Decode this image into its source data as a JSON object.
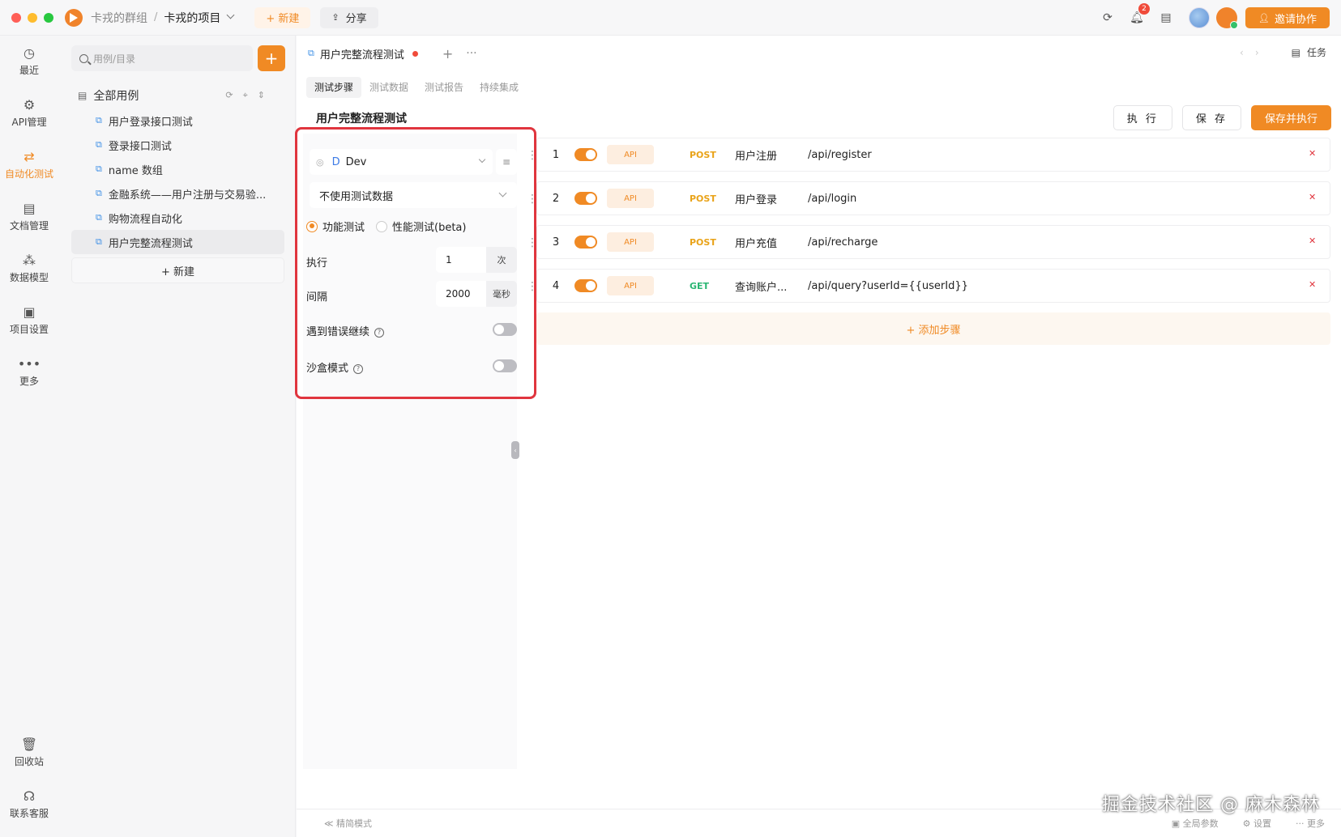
{
  "titlebar": {
    "group": "卡戎的群组",
    "separator": "/",
    "project": "卡戎的项目",
    "new_label": "+ 新建",
    "share_label": "分享",
    "notification_count": "2",
    "invite_label": "邀请协作"
  },
  "leftnav": {
    "items": [
      {
        "label": "最近",
        "icon": "◷"
      },
      {
        "label": "API管理",
        "icon": "⚙"
      },
      {
        "label": "自动化测试",
        "icon": "⇄"
      },
      {
        "label": "文档管理",
        "icon": "▤"
      },
      {
        "label": "数据模型",
        "icon": "⁂"
      },
      {
        "label": "项目设置",
        "icon": "▣"
      },
      {
        "label": "更多",
        "icon": "•••"
      }
    ],
    "bottom": [
      {
        "label": "回收站",
        "icon": "🗑"
      },
      {
        "label": "联系客服",
        "icon": "☊"
      }
    ]
  },
  "tree": {
    "search_placeholder": "用例/目录",
    "plus": "+",
    "root_label": "全部用例",
    "items": [
      "用户登录接口测试",
      "登录接口测试",
      "name 数组",
      "金融系统——用户注册与交易验...",
      "购物流程自动化",
      "用户完整流程测试"
    ],
    "new_label": "+  新建"
  },
  "tabs": {
    "active_tab": "用户完整流程测试",
    "plus": "+",
    "more": "···",
    "tasks_label": "任务",
    "subtabs": [
      "测试步骤",
      "测试数据",
      "测试报告",
      "持续集成"
    ]
  },
  "main": {
    "title": "用户完整流程测试",
    "run_label": "执 行",
    "save_label": "保 存",
    "save_run_label": "保存并执行"
  },
  "config": {
    "env_letter": "D",
    "env_name": "Dev",
    "test_data": "不使用测试数据",
    "mode_functional": "功能测试",
    "mode_performance": "性能测试(beta)",
    "run_label": "执行",
    "run_count": "1",
    "run_unit": "次",
    "interval_label": "间隔",
    "interval_value": "2000",
    "interval_unit": "毫秒",
    "continue_on_error": "遇到错误继续",
    "sandbox": "沙盒模式",
    "help_glyph": "?"
  },
  "steps": [
    {
      "num": "1",
      "tag": "API",
      "method": "POST",
      "name": "用户注册",
      "path": "/api/register"
    },
    {
      "num": "2",
      "tag": "API",
      "method": "POST",
      "name": "用户登录",
      "path": "/api/login"
    },
    {
      "num": "3",
      "tag": "API",
      "method": "POST",
      "name": "用户充值",
      "path": "/api/recharge"
    },
    {
      "num": "4",
      "tag": "API",
      "method": "GET",
      "name": "查询账户...",
      "path": "/api/query?userId={{userId}}"
    }
  ],
  "add_step_label": "+  添加步骤",
  "bottombar": {
    "simple_mode": "≪   精简模式",
    "global_params": "全局参数",
    "settings": "设置",
    "more": "更多"
  },
  "watermark": "掘金技术社区 @ 麻木森林",
  "colors": {
    "accent": "#f08a24",
    "frame": "#e0353e",
    "post": "#e9a319",
    "get": "#2bb673"
  }
}
